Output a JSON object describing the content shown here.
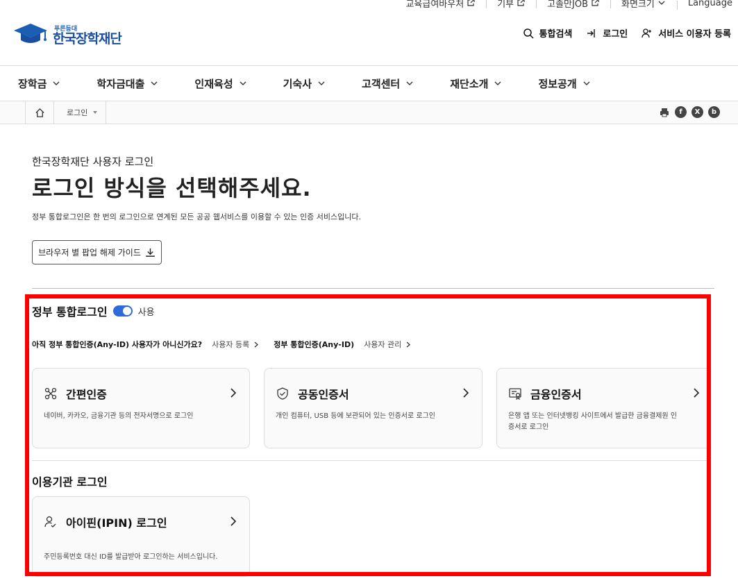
{
  "utility": [
    {
      "label": "교육급여바우처",
      "external": true
    },
    {
      "label": "기부",
      "external": true
    },
    {
      "label": "고졸만JOB",
      "external": true
    },
    {
      "label": "화면크기",
      "dropdown": true
    },
    {
      "label": "Language"
    }
  ],
  "logo": {
    "sub": "푸른등대",
    "main": "한국장학재단"
  },
  "header": {
    "search": "통합검색",
    "login": "로그인",
    "register": "서비스 이용자 등록"
  },
  "gnb": [
    "장학금",
    "학자금대출",
    "인재육성",
    "기숙사",
    "고객센터",
    "재단소개",
    "정보공개"
  ],
  "breadcrumb": {
    "current": "로그인"
  },
  "share_icons": [
    "print-icon",
    "facebook-icon",
    "x-icon",
    "blog-icon"
  ],
  "page": {
    "eyebrow": "한국장학재단 사용자 로그인",
    "title": "로그인 방식을 선택해주세요.",
    "desc": "정부 통합로그인은 한 번의 로그인으로 연계된 모든 공공 웹서비스를 이용할 수 있는 인증 서비스입니다.",
    "guide_button": "브라우저 별 팝업 해제 가이드"
  },
  "gov": {
    "title": "정부 통합로그인",
    "toggle_label": "사용",
    "toggle_on": true,
    "anyid_question": "아직 정부 통합인증(Any-ID) 사용자가 아니신가요?",
    "anyid_register": "사용자 등록",
    "anyid_title": "정부 통합인증(Any-ID)",
    "anyid_manage": "사용자 관리",
    "cards": [
      {
        "name": "간편인증",
        "desc": "네이버, 카카오, 금융기관 등의 전자서명으로 로그인",
        "icon": "simple-auth-icon"
      },
      {
        "name": "공동인증서",
        "desc": "개인 컴퓨터, USB 등에 보관되어 있는 인증서로 로그인",
        "icon": "shield-check-icon"
      },
      {
        "name": "금융인증서",
        "desc": "은행 앱 또는 인터넷뱅킹 사이트에서 발급한 금융결제원 인증서로 로그인",
        "icon": "certificate-icon"
      }
    ]
  },
  "institution": {
    "title": "이용기관 로그인",
    "cards": [
      {
        "name": "아이핀(IPIN) 로그인",
        "desc": "주민등록번호 대신 ID를 발급받아 로그인하는 서비스입니다.",
        "icon": "user-check-icon"
      }
    ]
  },
  "colors": {
    "accent": "#2d6bd8",
    "brand": "#1a4ea0",
    "highlight": "#ff0000"
  }
}
